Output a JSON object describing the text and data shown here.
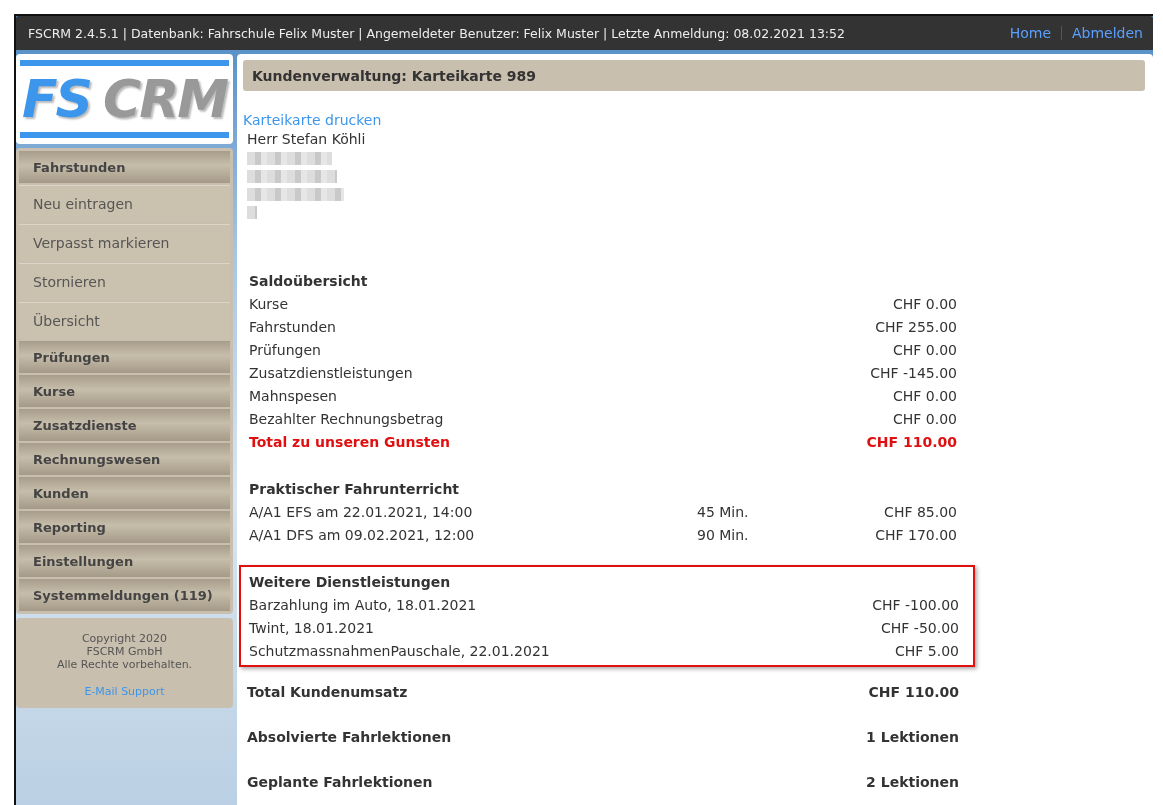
{
  "top_bar": {
    "info": "FSCRM 2.4.5.1 | Datenbank: Fahrschule Felix Muster | Angemeldeter Benutzer: Felix Muster | Letzte Anmeldung: 08.02.2021 13:52",
    "links": [
      "Home",
      "Abmelden"
    ]
  },
  "logo": {
    "part_1": "FS",
    "part_2": "CRM"
  },
  "sidebar": {
    "items": [
      {
        "label": "Fahrstunden",
        "kind": "group"
      },
      {
        "label": "Neu eintragen",
        "kind": "sub"
      },
      {
        "label": "Verpasst markieren",
        "kind": "sub"
      },
      {
        "label": "Stornieren",
        "kind": "sub"
      },
      {
        "label": "Übersicht",
        "kind": "sub"
      },
      {
        "label": "Prüfungen",
        "kind": "group"
      },
      {
        "label": "Kurse",
        "kind": "group"
      },
      {
        "label": "Zusatzdienste",
        "kind": "group"
      },
      {
        "label": "Rechnungswesen",
        "kind": "group"
      },
      {
        "label": "Kunden",
        "kind": "group"
      },
      {
        "label": "Reporting",
        "kind": "group"
      },
      {
        "label": "Einstellungen",
        "kind": "group"
      },
      {
        "label": "Systemmeldungen (119)",
        "kind": "group"
      }
    ],
    "footer": {
      "lines": [
        "Copyright 2020",
        "FSCRM GmbH",
        "Alle Rechte vorbehalten."
      ],
      "link": "E-Mail Support"
    }
  },
  "content": {
    "title": "Kundenverwaltung: Karteikarte 989",
    "print_link": "Karteikarte drucken",
    "customer_name": "Herr Stefan Köhli",
    "address_lines": [
      {
        "redacted": true
      },
      {
        "redacted": true
      },
      {
        "redacted": true
      },
      {
        "redacted": true
      }
    ],
    "sections": [
      {
        "title": "Saldoübersicht",
        "highlighted": false,
        "rows": [
          {
            "label": "Kurse",
            "amount": "CHF 0.00",
            "kind": "normal"
          },
          {
            "label": "Fahrstunden",
            "amount": "CHF 255.00",
            "kind": "normal"
          },
          {
            "label": "Prüfungen",
            "amount": "CHF 0.00",
            "kind": "normal"
          },
          {
            "label": "Zusatzdienstleistungen",
            "amount": "CHF -145.00",
            "kind": "normal"
          },
          {
            "label": "Mahnspesen",
            "amount": "CHF 0.00",
            "kind": "normal"
          },
          {
            "label": "Bezahlter Rechnungsbetrag",
            "amount": "CHF 0.00",
            "kind": "normal"
          },
          {
            "label": "Total zu unseren Gunsten",
            "amount": "CHF 110.00",
            "kind": "total"
          }
        ]
      },
      {
        "title": "Praktischer Fahrunterricht",
        "highlighted": false,
        "rows": [
          {
            "label": "A/A1 EFS am 22.01.2021, 14:00",
            "duration": "45 Min.",
            "amount": "CHF 85.00",
            "kind": "normal"
          },
          {
            "label": "A/A1 DFS am 09.02.2021, 12:00",
            "duration": "90 Min.",
            "amount": "CHF 170.00",
            "kind": "normal"
          }
        ]
      },
      {
        "title": "Weitere Dienstleistungen",
        "highlighted": true,
        "rows": [
          {
            "label": "Barzahlung im Auto, 18.01.2021",
            "amount": "CHF -100.00",
            "kind": "normal"
          },
          {
            "label": "Twint, 18.01.2021",
            "amount": "CHF -50.00",
            "kind": "normal"
          },
          {
            "label": "SchutzmassnahmenPauschale, 22.01.2021",
            "amount": "CHF 5.00",
            "kind": "normal"
          }
        ]
      },
      {
        "title": "Total Kundenumsatz",
        "value": "CHF 110.00",
        "highlighted": false
      },
      {
        "title": "Absolvierte Fahrlektionen",
        "value": "1 Lektionen",
        "highlighted": false
      },
      {
        "title": "Geplante Fahrlektionen",
        "value": "2 Lektionen",
        "highlighted": false
      }
    ]
  }
}
